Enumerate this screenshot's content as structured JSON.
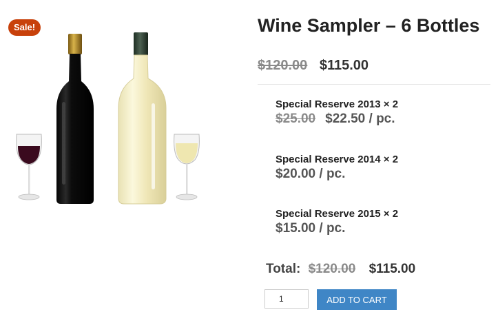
{
  "badge": {
    "label": "Sale!"
  },
  "product": {
    "title": "Wine Sampler – 6 Bottles",
    "price_old": "$120.00",
    "price_new": "$115.00"
  },
  "bundle_items": [
    {
      "name": "Special Reserve 2013 × 2",
      "price_old": "$25.00",
      "price": "$22.50 / pc."
    },
    {
      "name": "Special Reserve 2014 × 2",
      "price": "$20.00 / pc."
    },
    {
      "name": "Special Reserve 2015 × 2",
      "price": "$15.00 / pc."
    }
  ],
  "total": {
    "label": "Total:",
    "price_old": "$120.00",
    "price_new": "$115.00"
  },
  "cart": {
    "quantity": "1",
    "button_label": "ADD TO CART"
  },
  "colors": {
    "sale_badge": "#c8410b",
    "button": "#3f86c6"
  }
}
